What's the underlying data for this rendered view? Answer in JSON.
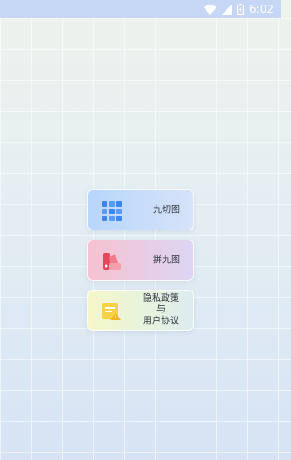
{
  "status_bar": {
    "time": "6:02",
    "icons": [
      "wifi-icon",
      "signal-icon",
      "battery-icon"
    ]
  },
  "menu": {
    "items": [
      {
        "label": "九切图",
        "icon": "grid-icon",
        "color": "#3b86f0"
      },
      {
        "label": "拼九图",
        "icon": "swatch-icon",
        "color": "#e8455a"
      },
      {
        "label_lines": [
          "隐私政策",
          "与",
          "用户协议"
        ],
        "icon": "document-icon",
        "color": "#f2c230"
      }
    ]
  }
}
